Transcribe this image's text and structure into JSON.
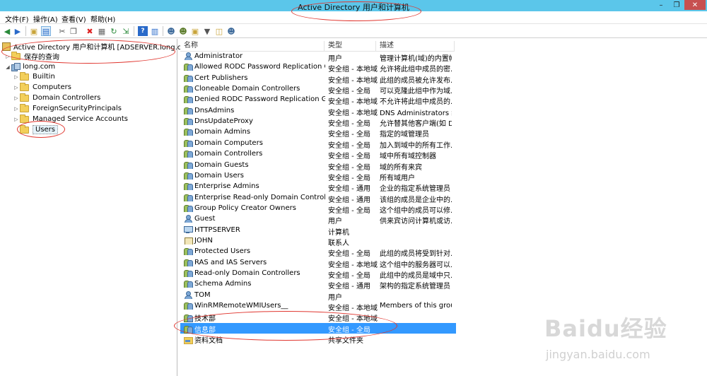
{
  "window": {
    "title": "Active Directory 用户和计算机",
    "controls": {
      "minimize": "–",
      "restore": "❐",
      "close": "✕"
    }
  },
  "menu": [
    "文件(F)",
    "操作(A)",
    "查看(V)",
    "帮助(H)"
  ],
  "toolbar": {
    "icons": [
      "back-icon",
      "forward-icon",
      "up-folder-icon",
      "show-tree-icon",
      "cut-icon",
      "copy-icon",
      "delete-icon",
      "properties-icon",
      "refresh-icon",
      "export-icon",
      "help-icon",
      "view-icon",
      "new-user-icon",
      "new-group-icon",
      "new-ou-icon",
      "filter-icon",
      "find-icon",
      "add-to-group-icon"
    ]
  },
  "tree": {
    "root": "Active Directory 用户和计算机 [ADSERVER.long.com]",
    "saved_queries": "保存的查询",
    "domain": "long.com",
    "children": [
      "Builtin",
      "Computers",
      "Domain Controllers",
      "ForeignSecurityPrincipals",
      "Managed Service Accounts",
      "Users"
    ],
    "selected": "Users"
  },
  "columns": {
    "name": "名称",
    "type": "类型",
    "description": "描述"
  },
  "rows": [
    {
      "name": "Administrator",
      "type": "用户",
      "description": "管理计算机(域)的内置帐...",
      "icon": "user"
    },
    {
      "name": "Allowed RODC Password Replication Group",
      "type": "安全组 - 本地域",
      "description": "允许将此组中成员的密...",
      "icon": "group"
    },
    {
      "name": "Cert Publishers",
      "type": "安全组 - 本地域",
      "description": "此组的成员被允许发布...",
      "icon": "group"
    },
    {
      "name": "Cloneable Domain Controllers",
      "type": "安全组 - 全局",
      "description": "可以克隆此组中作为域...",
      "icon": "group"
    },
    {
      "name": "Denied RODC Password Replication Group",
      "type": "安全组 - 本地域",
      "description": "不允许将此组中成员的...",
      "icon": "group"
    },
    {
      "name": "DnsAdmins",
      "type": "安全组 - 本地域",
      "description": "DNS Administrators 组",
      "icon": "group"
    },
    {
      "name": "DnsUpdateProxy",
      "type": "安全组 - 全局",
      "description": "允许替其他客户端(如 D...",
      "icon": "group"
    },
    {
      "name": "Domain Admins",
      "type": "安全组 - 全局",
      "description": "指定的域管理员",
      "icon": "group"
    },
    {
      "name": "Domain Computers",
      "type": "安全组 - 全局",
      "description": "加入到域中的所有工作...",
      "icon": "group"
    },
    {
      "name": "Domain Controllers",
      "type": "安全组 - 全局",
      "description": "域中所有域控制器",
      "icon": "group"
    },
    {
      "name": "Domain Guests",
      "type": "安全组 - 全局",
      "description": "域的所有来宾",
      "icon": "group"
    },
    {
      "name": "Domain Users",
      "type": "安全组 - 全局",
      "description": "所有域用户",
      "icon": "group"
    },
    {
      "name": "Enterprise Admins",
      "type": "安全组 - 通用",
      "description": "企业的指定系统管理员",
      "icon": "group"
    },
    {
      "name": "Enterprise Read-only Domain Controllers",
      "type": "安全组 - 通用",
      "description": "该组的成员是企业中的...",
      "icon": "group"
    },
    {
      "name": "Group Policy Creator Owners",
      "type": "安全组 - 全局",
      "description": "这个组中的成员可以修...",
      "icon": "group"
    },
    {
      "name": "Guest",
      "type": "用户",
      "description": "供来宾访问计算机或访...",
      "icon": "user"
    },
    {
      "name": "HTTPSERVER",
      "type": "计算机",
      "description": "",
      "icon": "computer"
    },
    {
      "name": "JOHN",
      "type": "联系人",
      "description": "",
      "icon": "contact"
    },
    {
      "name": "Protected Users",
      "type": "安全组 - 全局",
      "description": "此组的成员将受到针对...",
      "icon": "group"
    },
    {
      "name": "RAS and IAS Servers",
      "type": "安全组 - 本地域",
      "description": "这个组中的服务器可以...",
      "icon": "group"
    },
    {
      "name": "Read-only Domain Controllers",
      "type": "安全组 - 全局",
      "description": "此组中的成员是域中只...",
      "icon": "group"
    },
    {
      "name": "Schema Admins",
      "type": "安全组 - 通用",
      "description": "架构的指定系统管理员",
      "icon": "group"
    },
    {
      "name": "TOM",
      "type": "用户",
      "description": "",
      "icon": "user"
    },
    {
      "name": "WinRMRemoteWMIUsers__",
      "type": "安全组 - 本地域",
      "description": "Members of this grou...",
      "icon": "group"
    },
    {
      "name": "技术部",
      "type": "安全组 - 本地域",
      "description": "",
      "icon": "group"
    },
    {
      "name": "信息部",
      "type": "安全组 - 全局",
      "description": "",
      "icon": "group",
      "selected": true
    },
    {
      "name": "资料文档",
      "type": "共享文件夹",
      "description": "",
      "icon": "share"
    }
  ],
  "watermark": {
    "logo": "Baidu经验",
    "sub": "jingyan.baidu.com"
  },
  "colors": {
    "titlebar": "#5bc6ea",
    "selection": "#3399ff",
    "annotation": "#e0362f"
  }
}
